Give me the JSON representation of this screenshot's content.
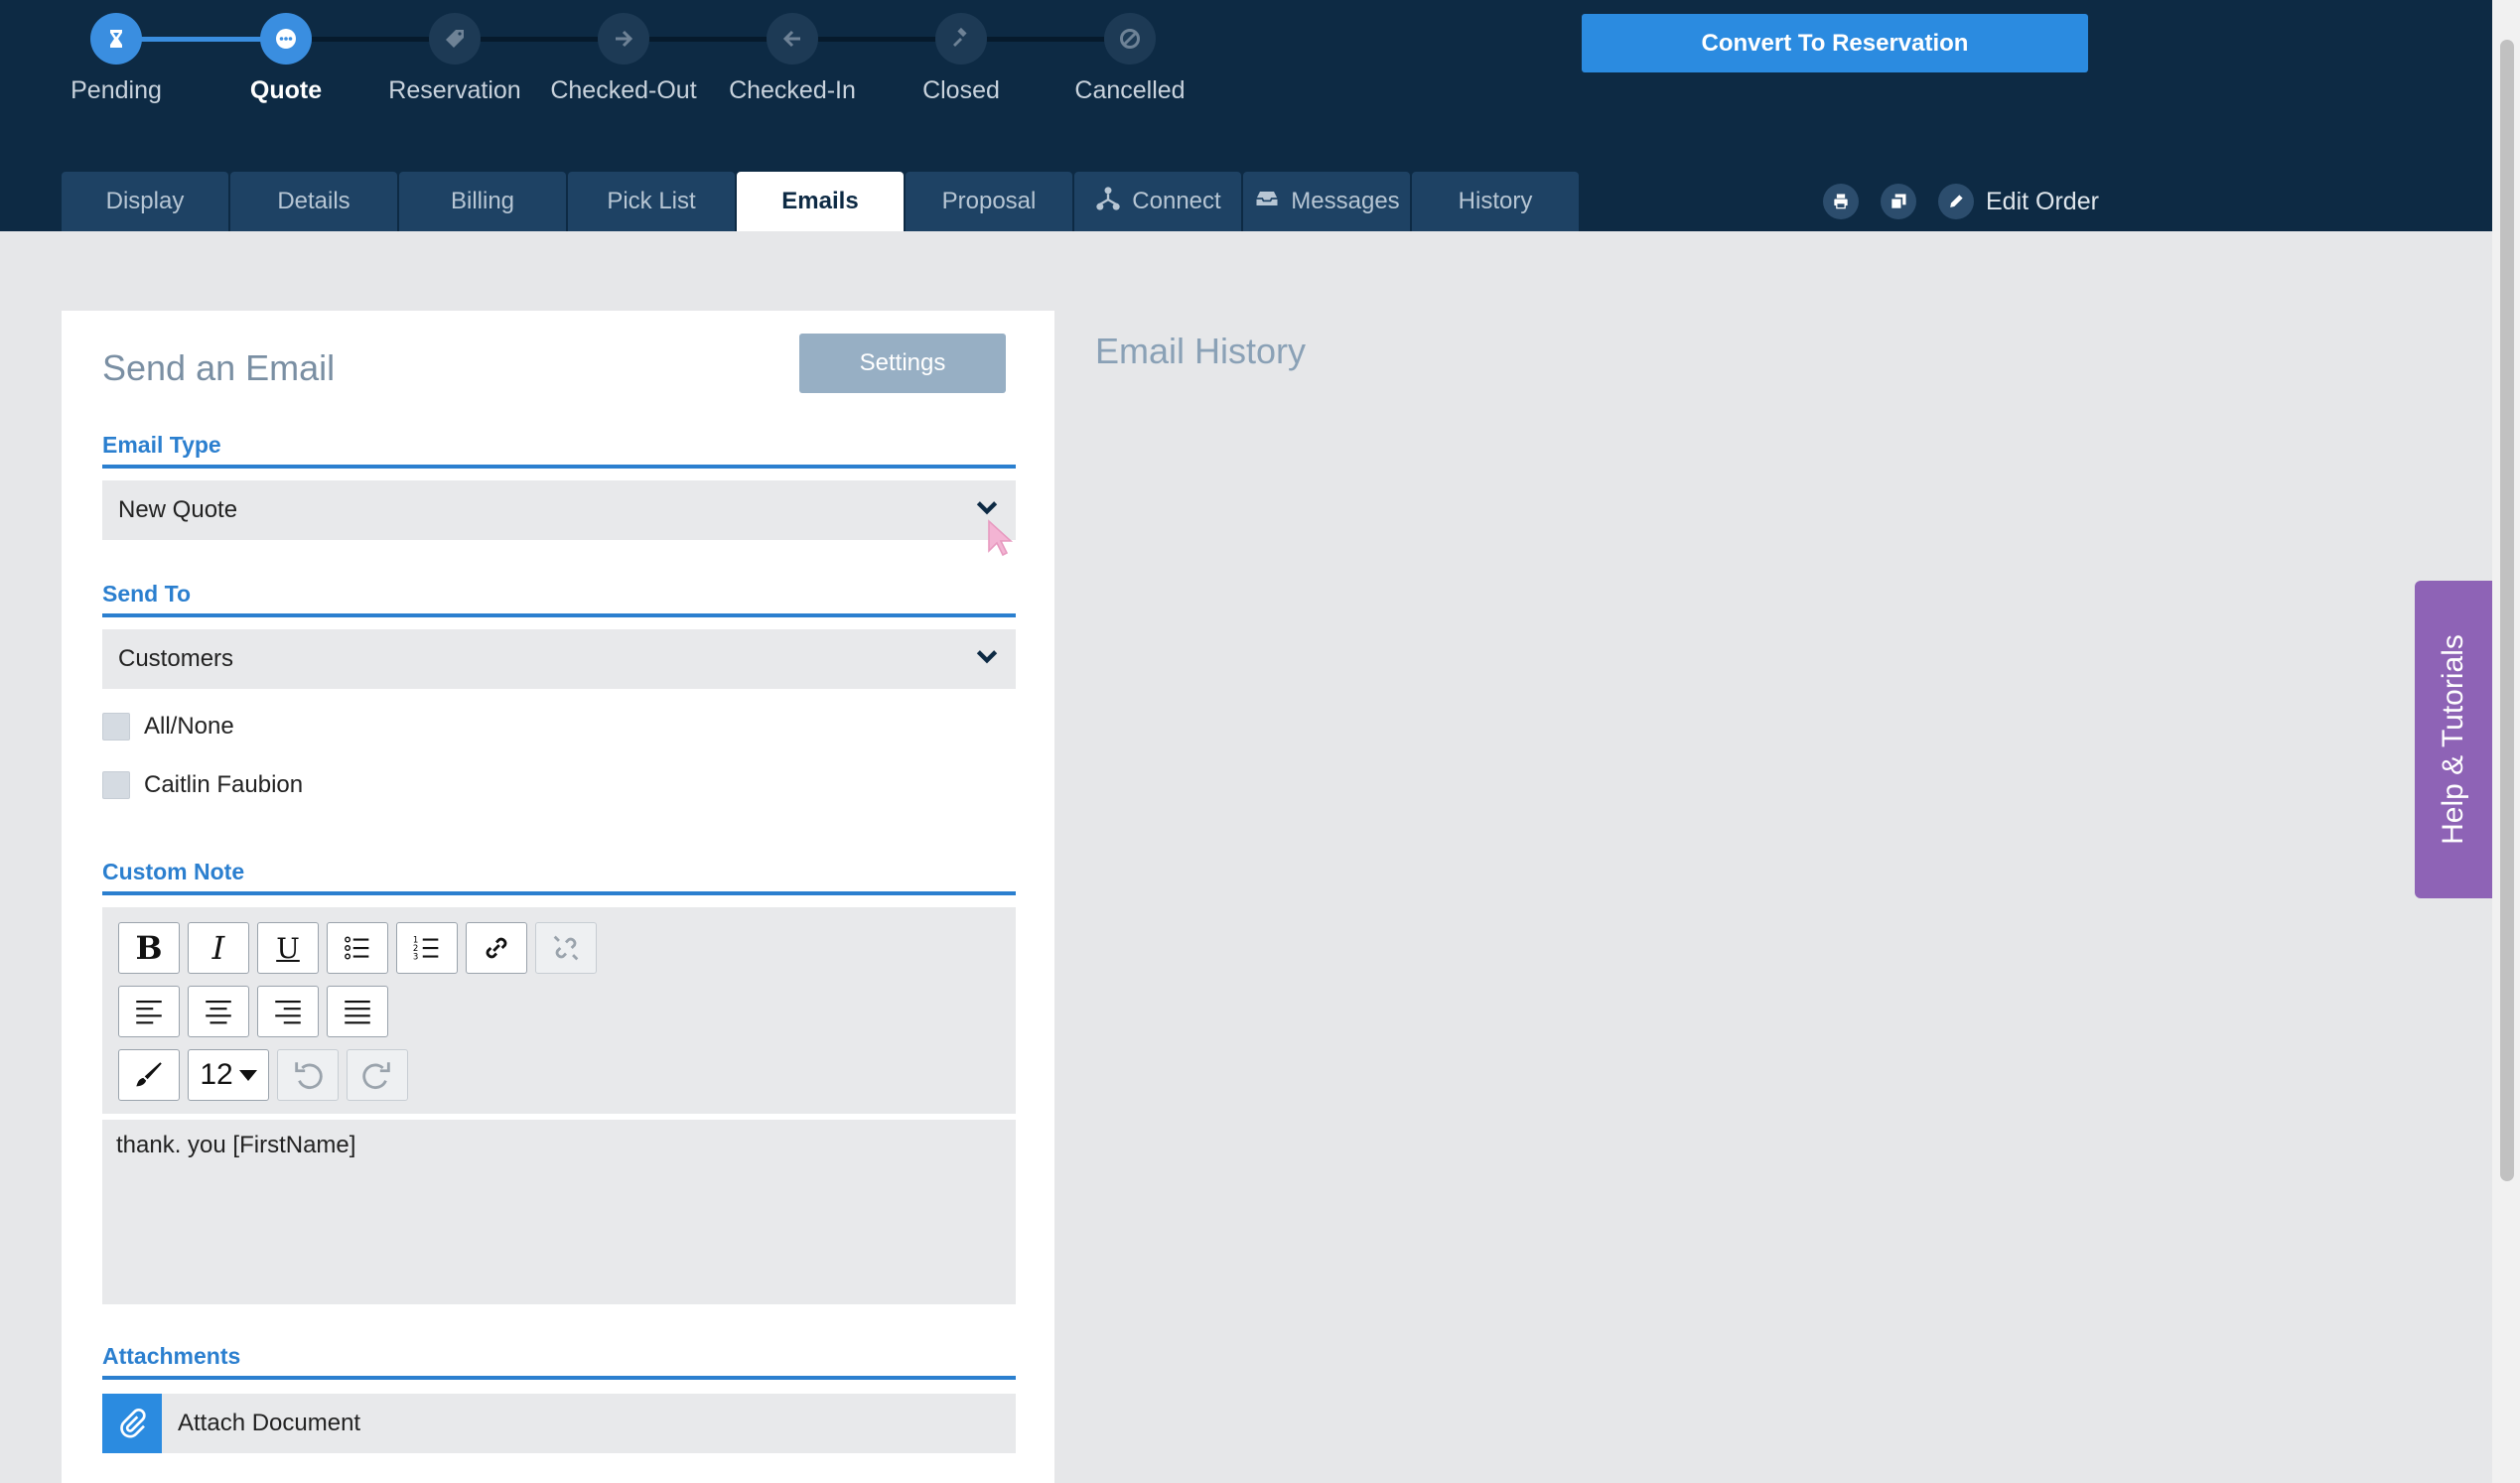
{
  "workflow": {
    "steps": [
      {
        "label": "Pending",
        "icon": "hourglass-icon"
      },
      {
        "label": "Quote",
        "icon": "ellipsis-icon"
      },
      {
        "label": "Reservation",
        "icon": "tag-icon"
      },
      {
        "label": "Checked-Out",
        "icon": "arrow-right-icon"
      },
      {
        "label": "Checked-In",
        "icon": "arrow-left-icon"
      },
      {
        "label": "Closed",
        "icon": "gavel-icon"
      },
      {
        "label": "Cancelled",
        "icon": "ban-icon"
      }
    ],
    "current_step": "Quote"
  },
  "header": {
    "convert_label": "Convert To Reservation",
    "edit_order_label": "Edit Order",
    "tabs": [
      {
        "label": "Display"
      },
      {
        "label": "Details"
      },
      {
        "label": "Billing"
      },
      {
        "label": "Pick List"
      },
      {
        "label": "Emails",
        "active": true
      },
      {
        "label": "Proposal"
      },
      {
        "label": "Connect",
        "icon": "network-icon"
      },
      {
        "label": "Messages",
        "icon": "inbox-icon"
      },
      {
        "label": "History"
      }
    ]
  },
  "email_form": {
    "title": "Send an Email",
    "settings_label": "Settings",
    "email_type_label": "Email Type",
    "email_type_value": "New Quote",
    "send_to_label": "Send To",
    "send_to_value": "Customers",
    "recipients": [
      {
        "label": "All/None",
        "checked": false
      },
      {
        "label": "Caitlin Faubion",
        "checked": false
      }
    ],
    "custom_note_label": "Custom Note",
    "font_size": "12",
    "note_text": "thank. you [FirstName]",
    "attachments_label": "Attachments",
    "attach_label": "Attach Document"
  },
  "email_history": {
    "title": "Email History"
  },
  "help": {
    "label": "Help & Tutorials"
  },
  "colors": {
    "header_bg": "#0d2a44",
    "accent_blue": "#2b8be0",
    "section_blue": "#2b7fcf",
    "help_purple": "#8e63b6"
  }
}
